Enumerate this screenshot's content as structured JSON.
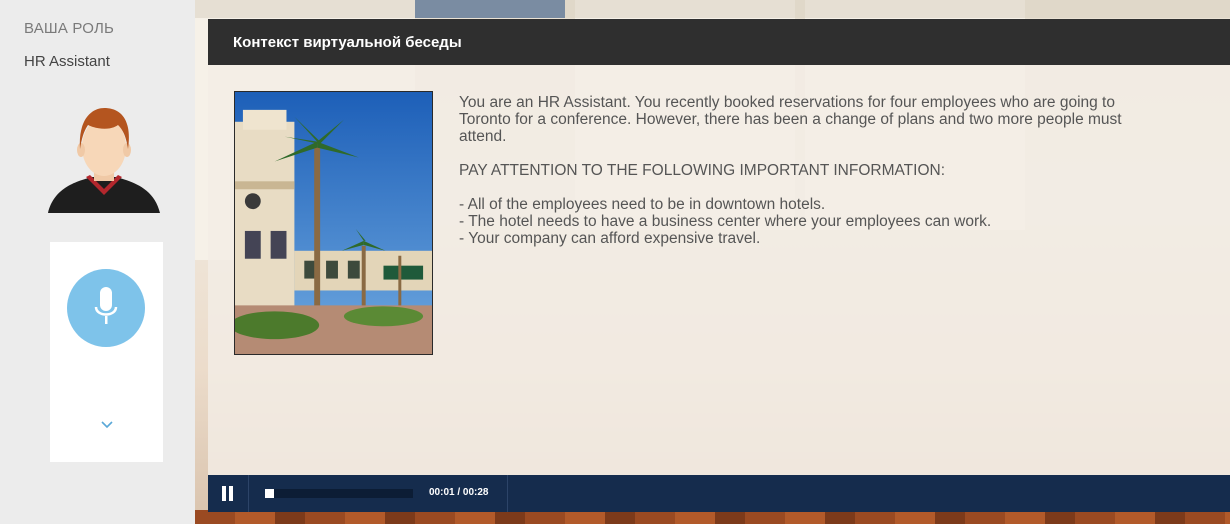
{
  "sidebar": {
    "role_title": "ВАША РОЛЬ",
    "role_name": "HR Assistant",
    "avatar_icon": "user-avatar-icon",
    "mic_icon": "microphone-icon",
    "chevron_icon": "chevron-down-icon",
    "mic_color": "#7ec3ea"
  },
  "dialog": {
    "title": "Контекст виртуальной беседы",
    "intro": "You are an HR Assistant. You recently booked reservations for four employees who are going to Toronto for a conference. However, there has been a change of plans and two more people must attend.",
    "attention": "PAY ATTENTION TO THE FOLLOWING IMPORTANT INFORMATION:",
    "bullets": [
      "- All of the employees need to be in downtown hotels.",
      "- The hotel needs to have a business center where your employees can work.",
      "- Your company can afford expensive travel."
    ]
  },
  "player": {
    "time": "00:01 / 00:28",
    "progress": 0.036,
    "pause_icon": "pause-icon",
    "bar_color": "#152c4d"
  }
}
